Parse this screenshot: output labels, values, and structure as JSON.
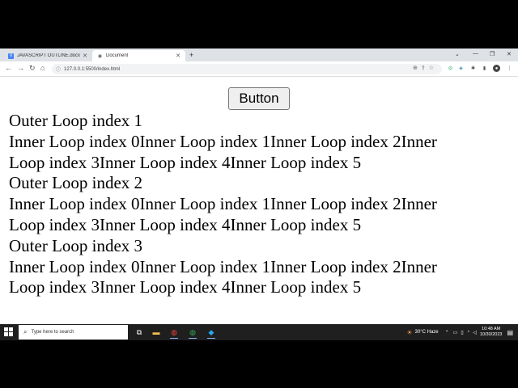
{
  "browser": {
    "tabs": [
      {
        "title": "JAVASCRIPT OUTLINE.docx",
        "active": false,
        "icon": "google-docs-icon"
      },
      {
        "title": "Document",
        "active": true,
        "icon": "globe-icon"
      }
    ],
    "address": "127.0.0.1:5500/index.html"
  },
  "page": {
    "button_label": "Button",
    "lines": [
      "Outer Loop index 1",
      "Inner Loop index 0Inner Loop index 1Inner Loop index 2Inner",
      "Loop index 3Inner Loop index 4Inner Loop index 5",
      "Outer Loop index 2",
      "Inner Loop index 0Inner Loop index 1Inner Loop index 2Inner",
      "Loop index 3Inner Loop index 4Inner Loop index 5",
      "Outer Loop index 3",
      "Inner Loop index 0Inner Loop index 1Inner Loop index 2Inner",
      "Loop index 3Inner Loop index 4Inner Loop index 5"
    ]
  },
  "taskbar": {
    "search_placeholder": "Type here to search",
    "weather": "30°C  Haze",
    "time": "10:48 AM",
    "date": "10/30/2023"
  },
  "colors": {
    "taskbar_bg": "#1f1f1f",
    "tabstrip_bg": "#dee1e6",
    "accent": "#8ab4f8"
  }
}
